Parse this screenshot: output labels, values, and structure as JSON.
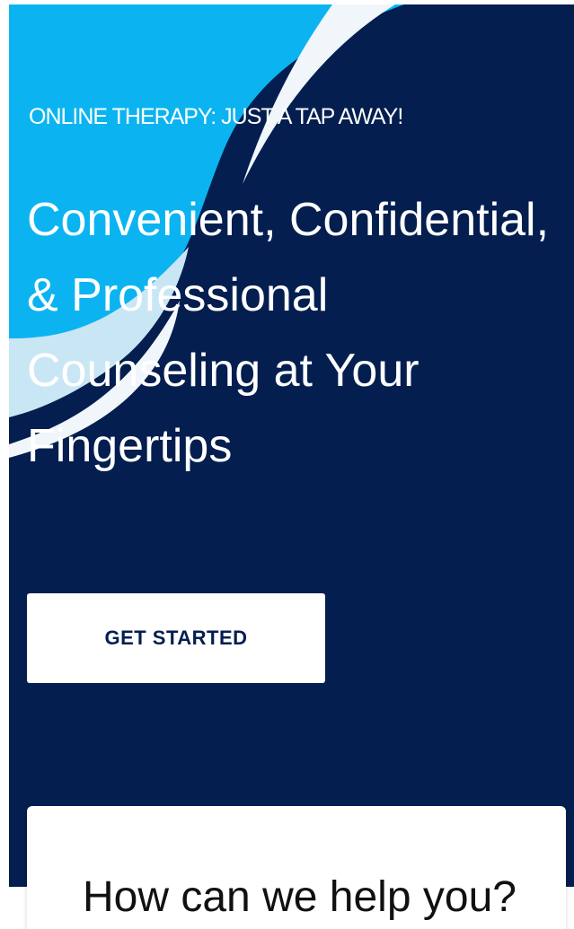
{
  "hero": {
    "eyebrow": "ONLINE THERAPY: JUST A TAP AWAY!",
    "headline": "Convenient, Confidential, & Professional Counseling at Your Fingertips",
    "cta_label": "GET STARTED",
    "background_color": "#031e4f",
    "wave_light_color": "#0bb4f0",
    "wave_white_color": "#f0f6fa"
  },
  "help_card": {
    "title": "How can we help you?"
  }
}
